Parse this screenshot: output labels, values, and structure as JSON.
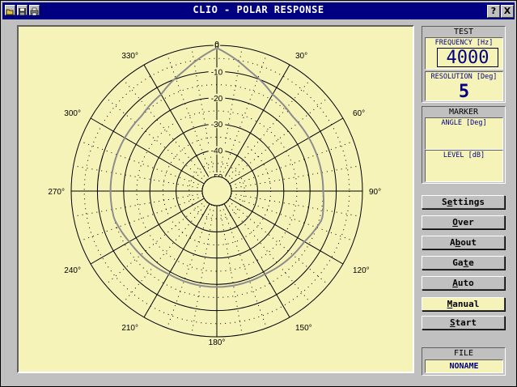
{
  "window": {
    "title": "CLIO - POLAR RESPONSE",
    "icons": [
      "open-folder-icon",
      "save-disk-icon",
      "print-icon"
    ],
    "help_label": "?",
    "close_label": "X"
  },
  "polar": {
    "ring_labels": [
      "0",
      "-10",
      "-20",
      "-30",
      "-40",
      "-50"
    ],
    "angle_labels": [
      "0",
      "30°",
      "60°",
      "90°",
      "120°",
      "150°",
      "180°",
      "210°",
      "240°",
      "270°",
      "300°",
      "330°"
    ],
    "colors": {
      "background": "#f6f3b9",
      "grid": "#000000",
      "trace": "#8c8c8c"
    }
  },
  "chart_data": {
    "type": "polar",
    "title": "",
    "radial_unit": "dB",
    "rlim": [
      -50,
      0
    ],
    "angle_step_deg": 30,
    "angles_deg": [
      0,
      15,
      30,
      45,
      60,
      75,
      90,
      105,
      120,
      135,
      150,
      165,
      180,
      195,
      210,
      225,
      240,
      255,
      270,
      285,
      300,
      315,
      330,
      345,
      360
    ],
    "series": [
      {
        "values_db": [
          -1,
          -8,
          -13,
          -15,
          -15,
          -15,
          -15,
          -14,
          -17,
          -18,
          -19,
          -19,
          -19,
          -19,
          -19,
          -18,
          -17,
          -15,
          -15,
          -15,
          -15,
          -15,
          -13,
          -8,
          -1
        ]
      }
    ]
  },
  "test": {
    "title": "TEST",
    "frequency_label": "FREQUENCY [Hz]",
    "frequency_value": "4000",
    "resolution_label": "RESOLUTION [Deg]",
    "resolution_value": "5"
  },
  "marker": {
    "title": "MARKER",
    "angle_label": "ANGLE [Deg]",
    "level_label": "LEVEL [dB]"
  },
  "buttons": [
    {
      "pre": "S",
      "ul": "e",
      "post": "ttings"
    },
    {
      "pre": "",
      "ul": "O",
      "post": "ver"
    },
    {
      "pre": "A",
      "ul": "b",
      "post": "out"
    },
    {
      "pre": "Ga",
      "ul": "t",
      "post": "e"
    },
    {
      "pre": "",
      "ul": "A",
      "post": "uto"
    },
    {
      "pre": "",
      "ul": "M",
      "post": "anual"
    },
    {
      "pre": "",
      "ul": "S",
      "post": "tart"
    }
  ],
  "file": {
    "title": "FILE",
    "name": "NONAME"
  }
}
